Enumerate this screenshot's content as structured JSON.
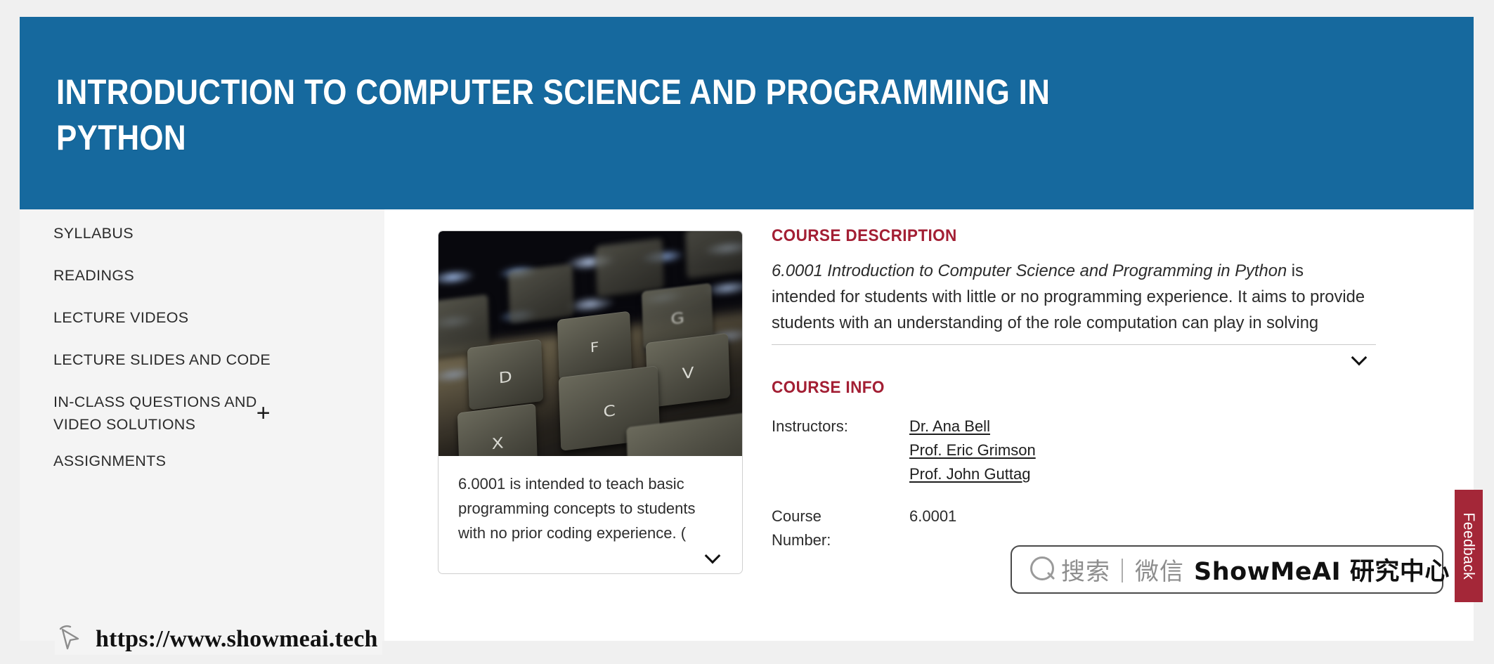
{
  "banner": {
    "title": "Introduction to Computer Science and Programming in Python"
  },
  "sidebar": {
    "items": [
      {
        "label": "Syllabus",
        "expander": ""
      },
      {
        "label": "Readings",
        "expander": ""
      },
      {
        "label": "Lecture Videos",
        "expander": ""
      },
      {
        "label": "Lecture Slides and Code",
        "expander": ""
      },
      {
        "label": "In-Class Questions and Video Solutions",
        "expander": "+"
      },
      {
        "label": "Assignments",
        "expander": ""
      }
    ]
  },
  "media": {
    "image_alt": "backlit-keyboard-closeup",
    "keys": [
      "D",
      "F",
      "G",
      "X",
      "C",
      "V"
    ],
    "caption": "6.0001 is intended to teach basic programming concepts to students with no prior coding experience. (",
    "expand_icon": "chevron-down-icon"
  },
  "course_description": {
    "heading": "Course Description",
    "italic_lead": "6.0001 Introduction to Computer Science and Programming in Python",
    "body": " is intended for students with little or no programming experience. It aims to provide students with an understanding of the role computation can play in solving",
    "expand_icon": "chevron-down-icon"
  },
  "course_info": {
    "heading": "Course Info",
    "instructors_label": "Instructors:",
    "instructors": [
      "Dr. Ana Bell",
      "Prof. Eric Grimson",
      "Prof. John Guttag"
    ],
    "course_number_label": "Course Number:",
    "course_number": "6.0001"
  },
  "search_overlay": {
    "icon": "search-icon",
    "gray_text": "搜索｜微信",
    "bold_text": "ShowMeAI 研究中心"
  },
  "feedback": {
    "label": "Feedback"
  },
  "brand": {
    "icon": "cursor-pointer-icon",
    "url": "https://www.showmeai.tech"
  },
  "colors": {
    "banner_blue": "#16699e",
    "heading_red": "#a31f34",
    "feedback_red": "#a42738",
    "sidebar_gray": "#f4f4f4",
    "page_bg": "#f0f0f0"
  }
}
